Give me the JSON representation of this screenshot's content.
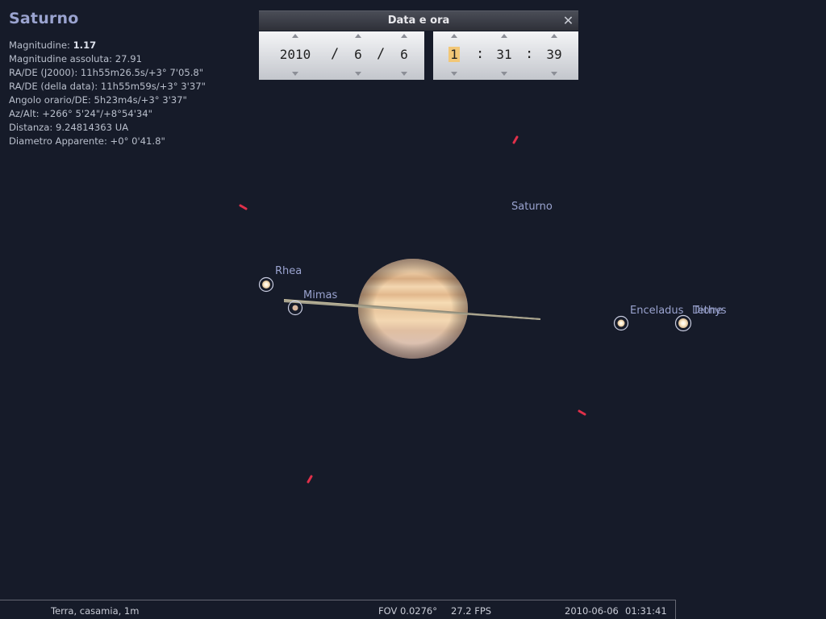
{
  "info_panel": {
    "object_name": "Saturno",
    "lines": [
      {
        "label": "Magnitudine: ",
        "value": "1.17"
      },
      {
        "label": "Magnitudine assoluta: 27.91"
      },
      {
        "label": "RA/DE (J2000): 11h55m26.5s/+3° 7'05.8\""
      },
      {
        "label": "RA/DE (della data): 11h55m59s/+3° 3'37\""
      },
      {
        "label": "Angolo orario/DE: 5h23m4s/+3° 3'37\""
      },
      {
        "label": "Az/Alt: +266° 5'24\"/+8°54'34\""
      },
      {
        "label": "Distanza: 9.24814363 UA"
      },
      {
        "label": "Diametro Apparente: +0° 0'41.8\""
      }
    ]
  },
  "datetime_dialog": {
    "title": "Data e ora",
    "close_icon": "close-icon",
    "date": {
      "year": "2010",
      "month": "6",
      "day": "6",
      "separator": "/"
    },
    "time": {
      "hour": "1",
      "minute": "31",
      "second": "39",
      "separator": ":"
    },
    "highlight_color": "#f2c777"
  },
  "sky": {
    "labels": {
      "saturn": "Saturno",
      "rhea": "Rhea",
      "mimas": "Mimas",
      "enceladus": "Enceladus",
      "tethys": "Tethys",
      "dione": "Dione"
    },
    "marker_color": "#e0304a"
  },
  "bottom_bar": {
    "location": "Terra, casamia, 1m",
    "fov": "FOV 0.0276°",
    "fps": "27.2 FPS",
    "date": "2010-06-06",
    "time": "01:31:41"
  }
}
